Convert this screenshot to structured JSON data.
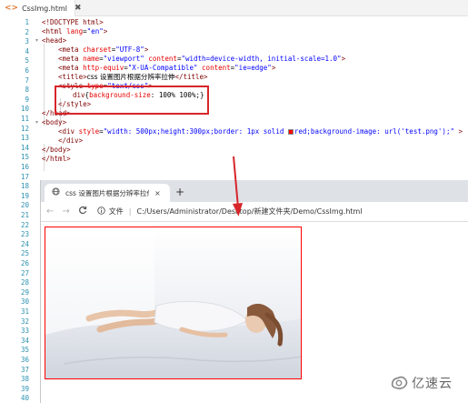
{
  "editor": {
    "tab": {
      "label": "CssImg.html",
      "icon": "html-file-icon",
      "close": "✖"
    },
    "line_numbers": [
      "1",
      "2",
      "3",
      "4",
      "5",
      "6",
      "7",
      "8",
      "9",
      "10",
      "11",
      "12",
      "13",
      "14",
      "15",
      "16",
      "17",
      "18",
      "19",
      "20",
      "21",
      "22",
      "23",
      "24",
      "25",
      "26",
      "27",
      "28",
      "29",
      "30",
      "31",
      "32",
      "33",
      "34",
      "35",
      "36",
      "37",
      "38",
      "39",
      "40"
    ],
    "code": {
      "l1": "<!DOCTYPE html>",
      "l2_open": "<html ",
      "l2_attr": "lang",
      "l2_eq": "=",
      "l2_val": "\"en\"",
      "l2_close": ">",
      "l3": "<head>",
      "l4_open": "<meta ",
      "l4_attr": "charset",
      "l4_eq": "=",
      "l4_val": "\"UTF-8\"",
      "l4_close": ">",
      "l5_open": "<meta ",
      "l5_attr1": "name",
      "l5_eq1": "=",
      "l5_val1": "\"viewport\"",
      "l5_sp": " ",
      "l5_attr2": "content",
      "l5_eq2": "=",
      "l5_val2": "\"width=device-width, initial-scale=1.0\"",
      "l5_close": ">",
      "l6_open": "<meta ",
      "l6_attr1": "http-equiv",
      "l6_eq1": "=",
      "l6_val1": "\"X-UA-Compatible\"",
      "l6_sp": " ",
      "l6_attr2": "content",
      "l6_eq2": "=",
      "l6_val2": "\"ie=edge\"",
      "l6_close": ">",
      "l7_open": "<title>",
      "l7_text": "css 设置图片根据分辨率拉伸",
      "l7_close": "</title>",
      "l8_open": "<style ",
      "l8_attr": "type",
      "l8_eq": "=",
      "l8_val": "\"text/css\"",
      "l8_close": ">",
      "l9_sel": "div",
      "l9_brace": "{",
      "l9_prop": "background-size",
      "l9_colon": ": ",
      "l9_val": "100% 100%",
      "l9_end": ";}",
      "l10": "</style>",
      "l11": "</head>",
      "l12": "<body>",
      "l13_open": "<div ",
      "l13_attr": "style",
      "l13_eq": "=",
      "l13_val_a": "\"width: 500px;height:300px;border: 1px solid ",
      "l13_val_b": "red;background-image: url('test.png');\"",
      "l13_close": " >",
      "l14": "</div>",
      "l15": "</body>",
      "l16": "</html>"
    }
  },
  "browser": {
    "tab": {
      "title": "css 设置图片根据分辨率拉伸",
      "icon": "globe-icon",
      "close": "×"
    },
    "new_tab": "+",
    "nav": {
      "back": "←",
      "forward": "→",
      "reload": "C"
    },
    "address": {
      "info_label": "文件",
      "separator": "|",
      "url": "C:/Users/Administrator/Desktop/新建文件夹/Demo/CssImg.html"
    }
  },
  "watermark": {
    "text": "亿速云"
  },
  "colors": {
    "highlight": "#d7262b",
    "demo_border": "#ff0000",
    "tag": "#800000",
    "attr": "#e50000",
    "value": "#0000ff",
    "line_number": "#2b91af"
  }
}
